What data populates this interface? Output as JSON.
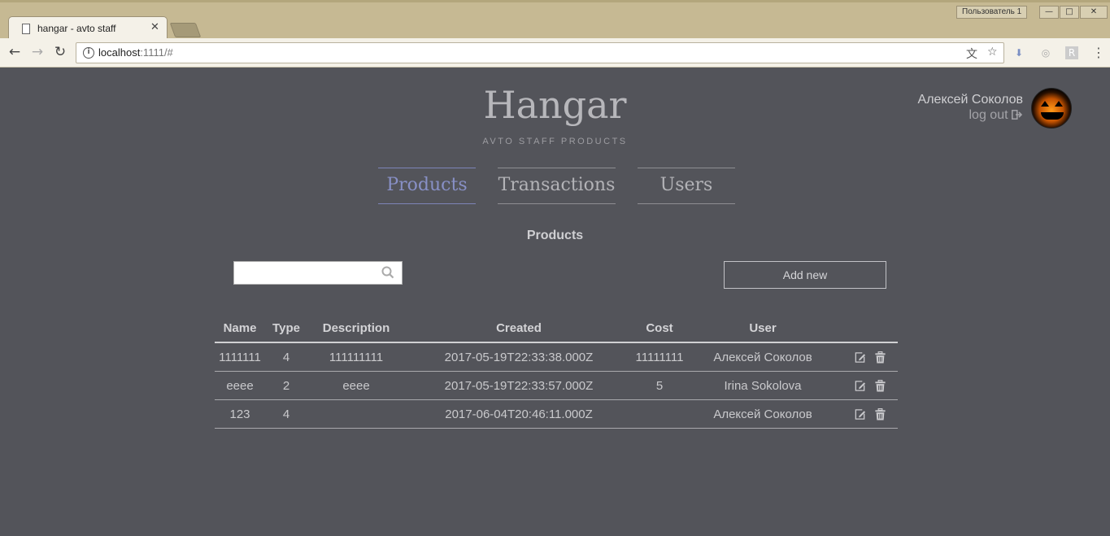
{
  "browser": {
    "tab_title": "hangar - avto staff",
    "tab_close": "✕",
    "profile": "Пользователь 1",
    "url_host": "localhost",
    "url_rest": ":1111/#",
    "win_min": "—",
    "win_max": "□",
    "win_close": "✕"
  },
  "header": {
    "brand": "Hangar",
    "subtitle": "AVTO STAFF PRODUCTS",
    "user_name": "Алексей Соколов",
    "logout": "log out"
  },
  "nav": [
    {
      "label": "Products",
      "active": true
    },
    {
      "label": "Transactions",
      "active": false
    },
    {
      "label": "Users",
      "active": false
    }
  ],
  "section_title": "Products",
  "search": {
    "value": "",
    "placeholder": ""
  },
  "add_new_label": "Add new",
  "table": {
    "columns": [
      "Name",
      "Type",
      "Description",
      "Created",
      "Cost",
      "User"
    ],
    "rows": [
      [
        "1111111",
        "4",
        "111111111",
        "2017-05-19T22:33:38.000Z",
        "11111111",
        "Алексей Соколов"
      ],
      [
        "eeee",
        "2",
        "eeee",
        "2017-05-19T22:33:57.000Z",
        "5",
        "Irina Sokolova"
      ],
      [
        "123",
        "4",
        "",
        "2017-06-04T20:46:11.000Z",
        "",
        "Алексей Соколов"
      ]
    ]
  },
  "icons": {
    "search": "search-icon",
    "edit": "edit-icon",
    "delete": "trash-icon",
    "logout": "sign-out-icon"
  },
  "colors": {
    "background": "#53545a",
    "active_nav": "#8890c6",
    "chrome": "#c6b993"
  }
}
